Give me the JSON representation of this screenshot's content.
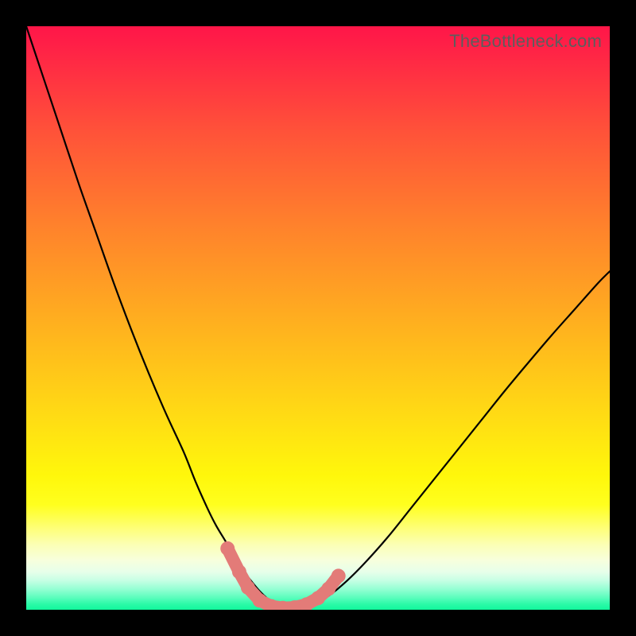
{
  "watermark": "TheBottleneck.com",
  "colors": {
    "curve_stroke": "#000000",
    "marker_stroke": "#e37b78",
    "marker_fill": "#e37b78"
  },
  "chart_data": {
    "type": "line",
    "title": "",
    "xlabel": "",
    "ylabel": "",
    "xlim": [
      0,
      100
    ],
    "ylim": [
      0,
      100
    ],
    "series": [
      {
        "name": "bottleneck-curve",
        "x": [
          0,
          3,
          6,
          9,
          12,
          15,
          18,
          21,
          24,
          27,
          29,
          31,
          32.5,
          34,
          35.5,
          37,
          38.5,
          40,
          41.5,
          43,
          45,
          47,
          49.5,
          52,
          55,
          58,
          62,
          66,
          70,
          74,
          78,
          82,
          86,
          90,
          94,
          98,
          100
        ],
        "y": [
          100,
          91,
          82,
          73,
          64.5,
          56,
          48,
          40.5,
          33.5,
          27,
          22,
          17.5,
          14.5,
          12,
          9.5,
          7,
          5,
          3.2,
          1.8,
          0.9,
          0.3,
          0.3,
          1.0,
          2.5,
          5,
          8,
          12.5,
          17.5,
          22.5,
          27.5,
          32.5,
          37.5,
          42.3,
          47,
          51.5,
          56,
          58
        ]
      }
    ],
    "markers": {
      "name": "bottom-cluster",
      "points": [
        {
          "x": 34.5,
          "y": 10.5
        },
        {
          "x": 36.5,
          "y": 6.5
        },
        {
          "x": 38.0,
          "y": 3.8
        },
        {
          "x": 40.0,
          "y": 1.6
        },
        {
          "x": 42.0,
          "y": 0.6
        },
        {
          "x": 44.0,
          "y": 0.3
        },
        {
          "x": 46.0,
          "y": 0.4
        },
        {
          "x": 48.0,
          "y": 0.9
        },
        {
          "x": 50.0,
          "y": 2.0
        },
        {
          "x": 51.8,
          "y": 3.6
        },
        {
          "x": 53.5,
          "y": 5.8
        }
      ]
    }
  }
}
